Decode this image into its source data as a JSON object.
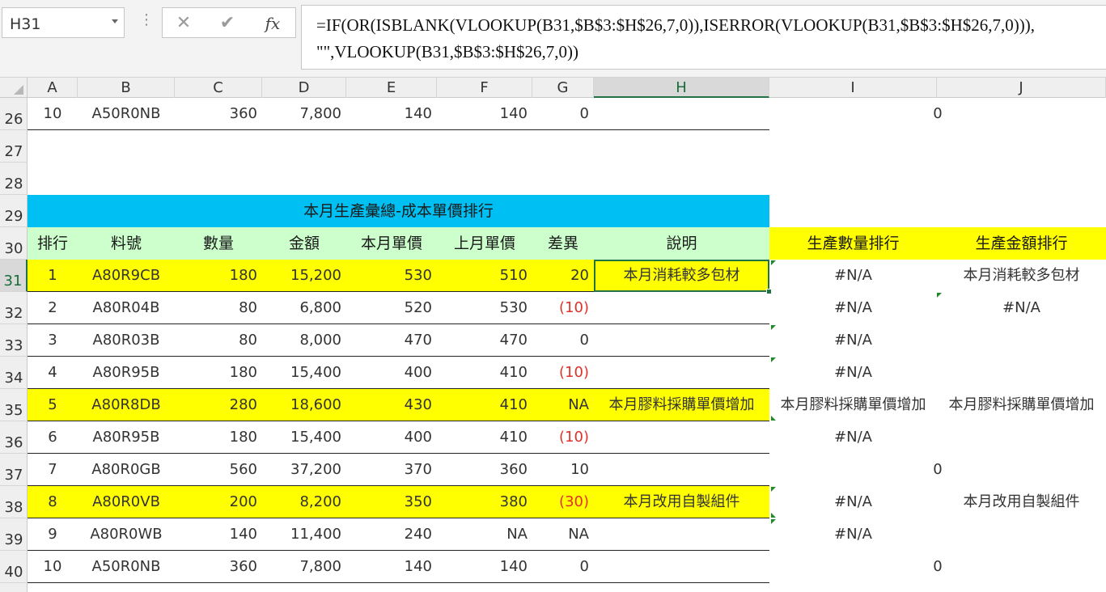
{
  "name_box": "H31",
  "toolbar": {
    "cancel": "✕",
    "enter": "✔",
    "fx": "fx",
    "dots": "⋮"
  },
  "formula": "=IF(OR(ISBLANK(VLOOKUP(B31,$B$3:$H$26,7,0)),ISERROR(VLOOKUP(B31,$B$3:$H$26,7,0))),\n\"\",VLOOKUP(B31,$B$3:$H$26,7,0))",
  "columns": [
    "A",
    "B",
    "C",
    "D",
    "E",
    "F",
    "G",
    "H",
    "I",
    "J"
  ],
  "active_column": "H",
  "rows": [
    "26",
    "27",
    "28",
    "29",
    "30",
    "31",
    "32",
    "33",
    "34",
    "35",
    "36",
    "37",
    "38",
    "39",
    "40"
  ],
  "active_row": "31",
  "row26": {
    "a": "10",
    "b": "A50R0NB",
    "c": "360",
    "d": "7,800",
    "e": "140",
    "f": "140",
    "g": "0",
    "ij": "0"
  },
  "title": "本月生產彙總-成本單價排行",
  "headers": {
    "a": "排行",
    "b": "料號",
    "c": "數量",
    "d": "金額",
    "e": "本月單價",
    "f": "上月單價",
    "g": "差異",
    "h": "說明",
    "i": "生產數量排行",
    "j": "生產金額排行"
  },
  "table": [
    {
      "rank": "1",
      "part": "A80R9CB",
      "qty": "180",
      "amount": "15,200",
      "cur": "530",
      "prev": "510",
      "diff": "20",
      "note": "本月消耗較多包材",
      "i": "#N/A",
      "j": "本月消耗較多包材"
    },
    {
      "rank": "2",
      "part": "A80R04B",
      "qty": "80",
      "amount": "6,800",
      "cur": "520",
      "prev": "530",
      "diff": "(10)",
      "note": "",
      "i": "#N/A",
      "j": "#N/A"
    },
    {
      "rank": "3",
      "part": "A80R03B",
      "qty": "80",
      "amount": "8,000",
      "cur": "470",
      "prev": "470",
      "diff": "0",
      "note": "",
      "i": "#N/A",
      "j": ""
    },
    {
      "rank": "4",
      "part": "A80R95B",
      "qty": "180",
      "amount": "15,400",
      "cur": "400",
      "prev": "410",
      "diff": "(10)",
      "note": "",
      "i": "#N/A",
      "j": ""
    },
    {
      "rank": "5",
      "part": "A80R8DB",
      "qty": "280",
      "amount": "18,600",
      "cur": "430",
      "prev": "410",
      "diff": "NA",
      "note": "本月膠料採購單價增加",
      "i": "本月膠料採購單價增加",
      "j": "本月膠料採購單價增加"
    },
    {
      "rank": "6",
      "part": "A80R95B",
      "qty": "180",
      "amount": "15,400",
      "cur": "400",
      "prev": "410",
      "diff": "(10)",
      "note": "",
      "i": "#N/A",
      "j": ""
    },
    {
      "rank": "7",
      "part": "A80R0GB",
      "qty": "560",
      "amount": "37,200",
      "cur": "370",
      "prev": "360",
      "diff": "10",
      "note": "",
      "ij": "0"
    },
    {
      "rank": "8",
      "part": "A80R0VB",
      "qty": "200",
      "amount": "8,200",
      "cur": "350",
      "prev": "380",
      "diff": "(30)",
      "note": "本月改用自製組件",
      "i": "#N/A",
      "j": "本月改用自製組件"
    },
    {
      "rank": "9",
      "part": "A80R0WB",
      "qty": "140",
      "amount": "11,400",
      "cur": "240",
      "prev": "NA",
      "diff": "NA",
      "note": "",
      "i": "#N/A",
      "j": ""
    },
    {
      "rank": "10",
      "part": "A50R0NB",
      "qty": "360",
      "amount": "7,800",
      "cur": "140",
      "prev": "140",
      "diff": "0",
      "note": "",
      "ij": "0"
    }
  ],
  "colors": {
    "excel_green": "#217346",
    "highlight": "#ffff00",
    "title_bg": "#00bff2",
    "header_bg": "#ccffcc",
    "negative": "#e0312b",
    "error_triangle": "#1e8a2a"
  }
}
